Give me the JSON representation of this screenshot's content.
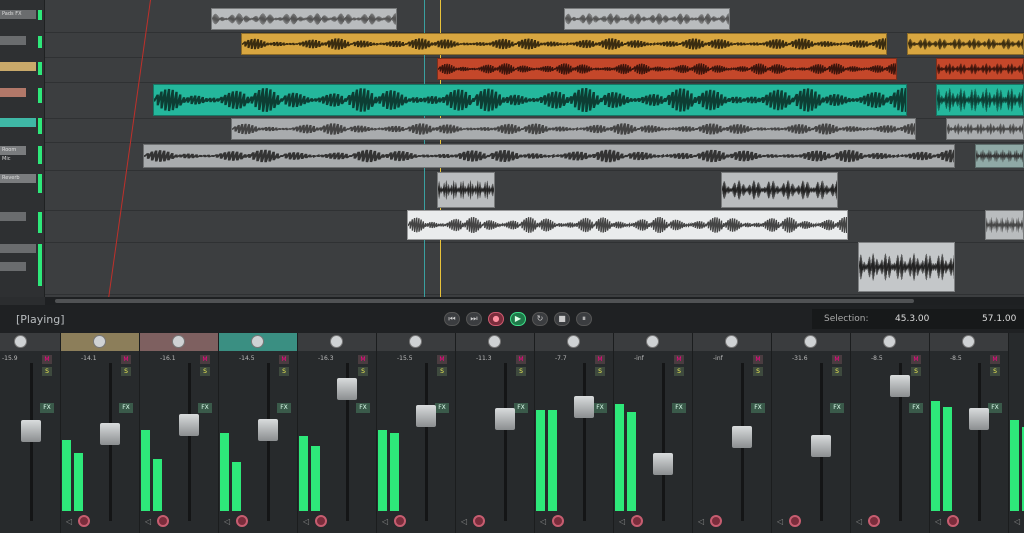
{
  "transport": {
    "status": "[Playing]",
    "selection_label": "Selection:",
    "selection_start": "45.3.00",
    "selection_end": "57.1.00",
    "buttons": [
      {
        "name": "skip-start",
        "icon": "skip-start-icon",
        "glyph": "⏮"
      },
      {
        "name": "skip-end",
        "icon": "skip-end-icon",
        "glyph": "⏭"
      },
      {
        "name": "record",
        "icon": "record-icon",
        "glyph": "●"
      },
      {
        "name": "play",
        "icon": "play-icon",
        "glyph": "▶"
      },
      {
        "name": "loop",
        "icon": "loop-icon",
        "glyph": "↻"
      },
      {
        "name": "stop",
        "icon": "stop-icon",
        "glyph": "■"
      },
      {
        "name": "pause",
        "icon": "pause-icon",
        "glyph": "⏸"
      }
    ]
  },
  "tracks": [
    {
      "name": "Pads FX",
      "color": "#6a6c6e"
    },
    {
      "name": "",
      "color": "#6a6c6e"
    },
    {
      "name": "",
      "color": "#c9a96a"
    },
    {
      "name": "",
      "color": "#b27869"
    },
    {
      "name": "",
      "color": "#3fb8a6"
    },
    {
      "name": "Room Mic",
      "color": "#7a7c7e"
    },
    {
      "name": "Reverb",
      "color": "#7a7c7e"
    }
  ],
  "clips": [
    {
      "lane": 0,
      "start": 0.17,
      "end": 0.36,
      "color": "#b9bcbe",
      "wave": "#555"
    },
    {
      "lane": 0,
      "start": 0.53,
      "end": 0.7,
      "color": "#b9bcbe",
      "wave": "#555"
    },
    {
      "lane": 1,
      "start": 0.2,
      "end": 0.86,
      "color": "#d8a640",
      "wave": "#3a2c10"
    },
    {
      "lane": 1,
      "start": 0.88,
      "end": 1.0,
      "color": "#d8a640",
      "wave": "#3a2c10"
    },
    {
      "lane": 2,
      "start": 0.4,
      "end": 0.87,
      "color": "#c4472a",
      "wave": "#3a140c"
    },
    {
      "lane": 2,
      "start": 0.91,
      "end": 1.0,
      "color": "#c4472a",
      "wave": "#3a140c"
    },
    {
      "lane": 3,
      "start": 0.11,
      "end": 0.88,
      "color": "#24b79c",
      "wave": "#0d3d33"
    },
    {
      "lane": 3,
      "start": 0.91,
      "end": 1.0,
      "color": "#24b79c",
      "wave": "#0d3d33"
    },
    {
      "lane": 4,
      "start": 0.19,
      "end": 0.89,
      "color": "#a9acae",
      "wave": "#444"
    },
    {
      "lane": 4,
      "start": 0.92,
      "end": 1.0,
      "color": "#a9acae",
      "wave": "#444"
    },
    {
      "lane": 5,
      "start": 0.1,
      "end": 0.93,
      "color": "#a9acae",
      "wave": "#333"
    },
    {
      "lane": 5,
      "start": 0.95,
      "end": 1.0,
      "color": "#8fa9a6",
      "wave": "#333"
    },
    {
      "lane": 6,
      "start": 0.4,
      "end": 0.46,
      "color": "#b9bcbe",
      "wave": "#222"
    },
    {
      "lane": 6,
      "start": 0.69,
      "end": 0.81,
      "color": "#b9bcbe",
      "wave": "#222"
    },
    {
      "lane": 7,
      "start": 0.37,
      "end": 0.82,
      "color": "#eaeced",
      "wave": "#444"
    },
    {
      "lane": 7,
      "start": 0.96,
      "end": 1.0,
      "color": "#b9bcbe",
      "wave": "#444"
    },
    {
      "lane": 8,
      "start": 0.83,
      "end": 0.93,
      "color": "#c4c7c9",
      "wave": "#222"
    }
  ],
  "mixer": {
    "channels": [
      {
        "db": "-15.9",
        "color": "#3a3c3e",
        "meters": [
          0.55,
          0.45
        ],
        "fader": 0.62
      },
      {
        "db": "-14.1",
        "color": "#8c7e5a",
        "meters": [
          0.62,
          0.4
        ],
        "fader": 0.6
      },
      {
        "db": "-16.1",
        "color": "#7e6060",
        "meters": [
          0.6,
          0.38
        ],
        "fader": 0.66
      },
      {
        "db": "-14.5",
        "color": "#3a8f82",
        "meters": [
          0.58,
          0.5
        ],
        "fader": 0.63
      },
      {
        "db": "-16.3",
        "color": "#3a3c3e",
        "meters": [
          0.62,
          0.6
        ],
        "fader": 0.9
      },
      {
        "db": "-15.5",
        "color": "#3a3c3e",
        "meters": [
          0.0,
          0.0
        ],
        "fader": 0.72
      },
      {
        "db": "-11.3",
        "color": "#3a3c3e",
        "meters": [
          0.78,
          0.78
        ],
        "fader": 0.7
      },
      {
        "db": "-7.7",
        "color": "#3a3c3e",
        "meters": [
          0.82,
          0.76
        ],
        "fader": 0.78
      },
      {
        "db": "-inf",
        "color": "#3a3c3e",
        "meters": [
          0.0,
          0.0
        ],
        "fader": 0.4
      },
      {
        "db": "-inf",
        "color": "#3a3c3e",
        "meters": [
          0.0,
          0.0
        ],
        "fader": 0.58
      },
      {
        "db": "-31.6",
        "color": "#3a3c3e",
        "meters": [
          0.0,
          0.0
        ],
        "fader": 0.52
      },
      {
        "db": "-8.5",
        "color": "#3a3c3e",
        "meters": [
          0.85,
          0.8
        ],
        "fader": 0.92
      },
      {
        "db": "-8.5",
        "color": "#3a3c3e",
        "meters": [
          0.7,
          0.65
        ],
        "fader": 0.7
      }
    ],
    "mute_label": "M",
    "solo_label": "S",
    "fx_label": "FX"
  }
}
